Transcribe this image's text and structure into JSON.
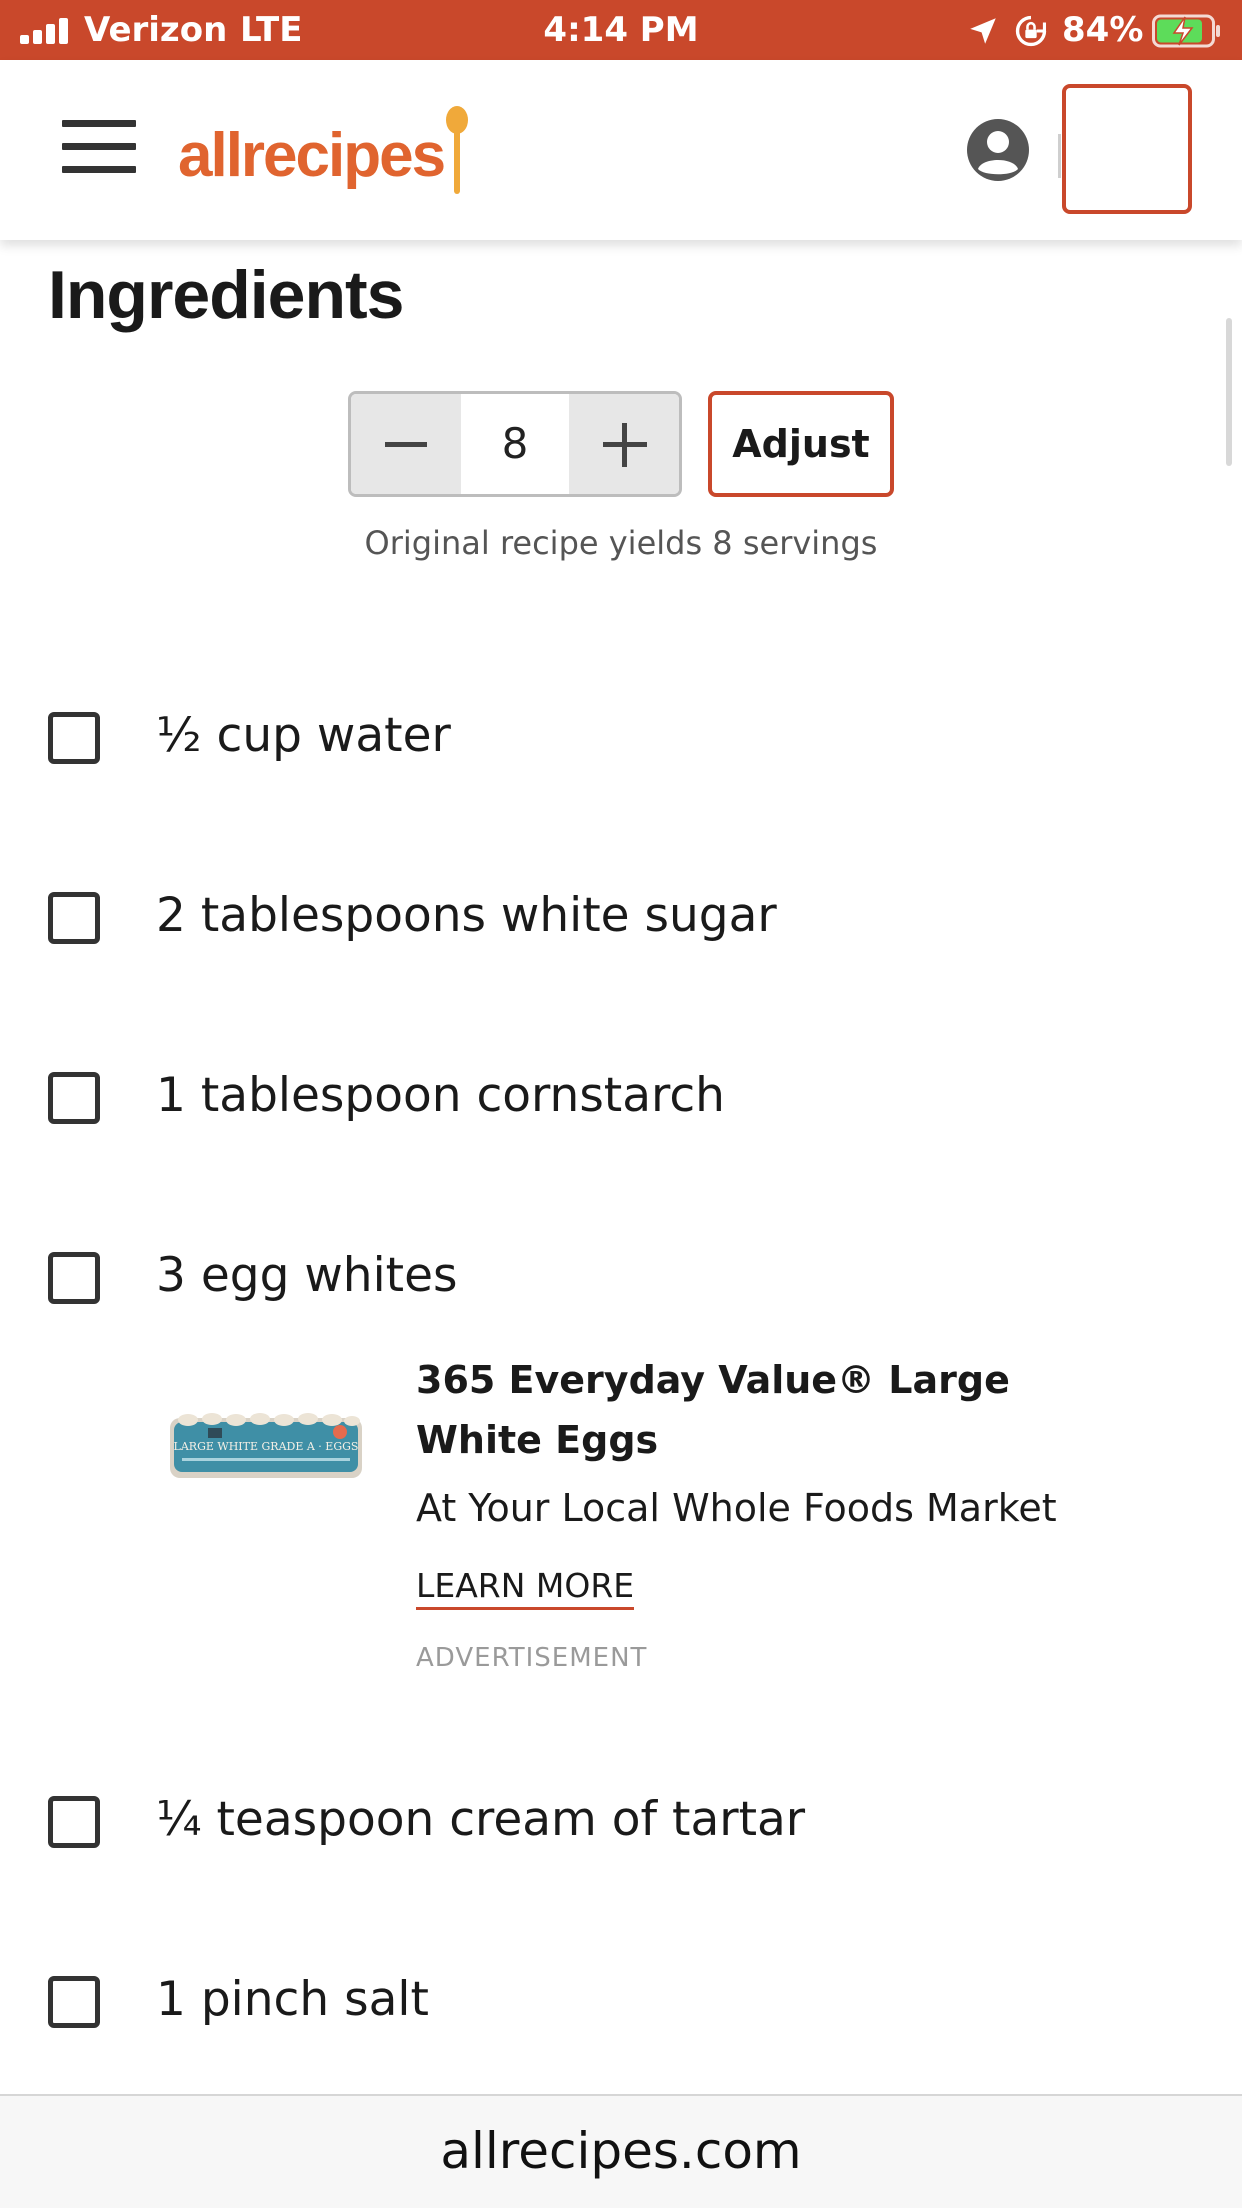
{
  "status_bar": {
    "carrier": "Verizon",
    "network": "LTE",
    "time": "4:14 PM",
    "battery_percent": "84%",
    "battery_level": 0.84
  },
  "header": {
    "logo_text": "allrecipes",
    "brand_color": "#e0642f",
    "accent_color": "#c9482b"
  },
  "main": {
    "title": "Ingredients",
    "servings": {
      "value": "8",
      "adjust_label": "Adjust",
      "yield_text": "Original recipe yields 8 servings"
    },
    "ingredients": [
      {
        "label": "½ cup water"
      },
      {
        "label": "2 tablespoons white sugar"
      },
      {
        "label": "1 tablespoon cornstarch"
      },
      {
        "label": "3 egg whites"
      },
      {
        "label": "¼ teaspoon cream of tartar"
      },
      {
        "label": "1 pinch salt"
      }
    ],
    "ad": {
      "title": "365 Everyday Value® Large White Eggs",
      "subtitle": "At Your Local Whole Foods Market",
      "link": "LEARN MORE",
      "label": "ADVERTISEMENT",
      "image_text": "LARGE WHITE GRADE A · EGGS"
    }
  },
  "bottom_bar": {
    "url": "allrecipes.com"
  }
}
